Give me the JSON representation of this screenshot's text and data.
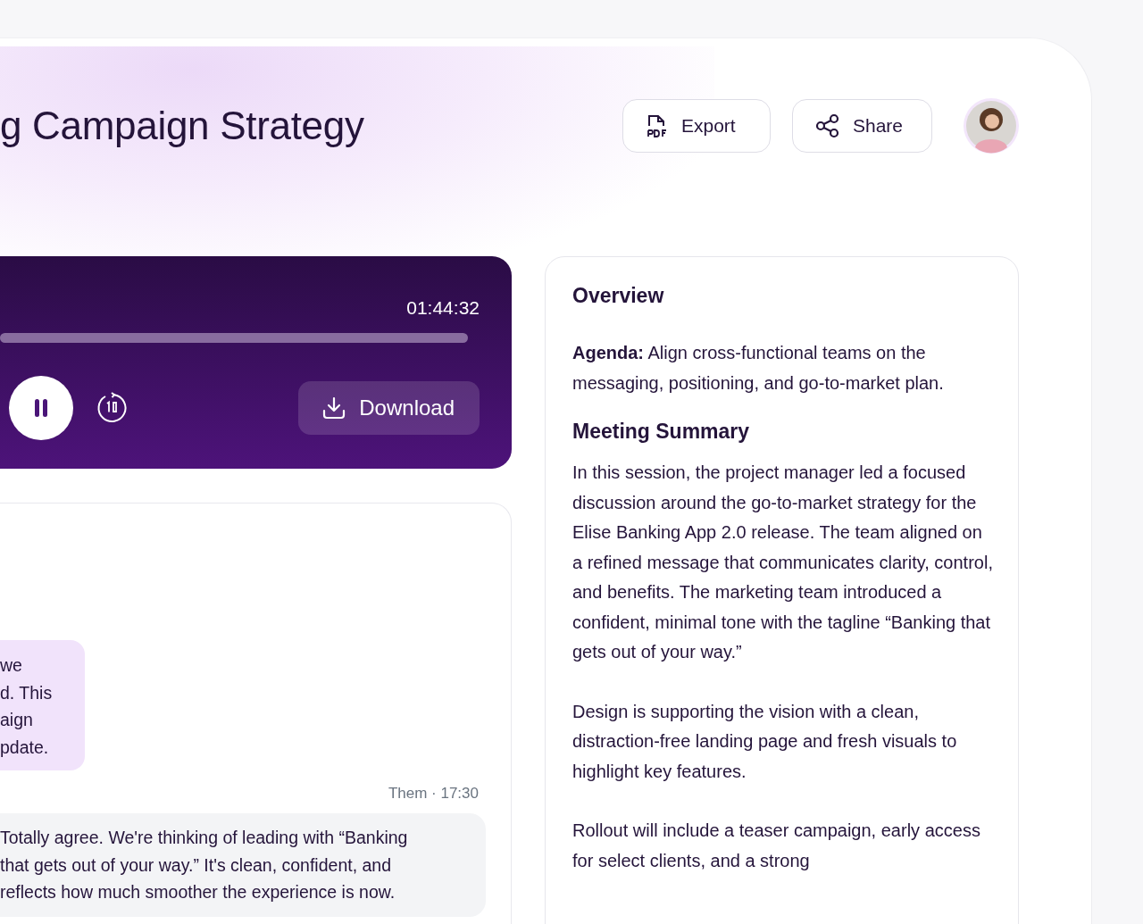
{
  "header": {
    "title": "g Campaign Strategy",
    "actions": [
      {
        "kind": "pdf",
        "label": "Export"
      },
      {
        "kind": "share",
        "label": "Share"
      }
    ]
  },
  "player": {
    "time": "01:44:32",
    "download": "Download"
  },
  "chat": {
    "messages": [
      {
        "kind": "me",
        "lines": [
          "we",
          "d. This",
          "aign",
          "pdate."
        ]
      },
      {
        "kind": "them",
        "meta": "Them · 17:30",
        "lines": [
          "Totally agree. We're thinking of leading with “Banking",
          "that gets out of your way.” It's clean, confident, and",
          "reflects how much smoother the experience is now."
        ]
      }
    ]
  },
  "overview": {
    "title": "Overview",
    "agenda": "**Agenda:** Align cross-functional teams on the messaging, positioning, and go-to-market plan.",
    "summary_title": "Meeting Summary",
    "paragraphs": [
      "In this session, the project manager led a focused discussion around the go-to-market strategy for the Elise Banking App 2.0 release. The team aligned on a refined message that communicates clarity, control, and benefits. The marketing team introduced a confident, minimal tone with the tagline “Banking that gets out of your way.”",
      "Design is supporting the vision with a clean, distraction-free landing page and fresh visuals to highlight key features.",
      "Rollout will include a teaser campaign, early access for select clients, and a strong"
    ]
  }
}
